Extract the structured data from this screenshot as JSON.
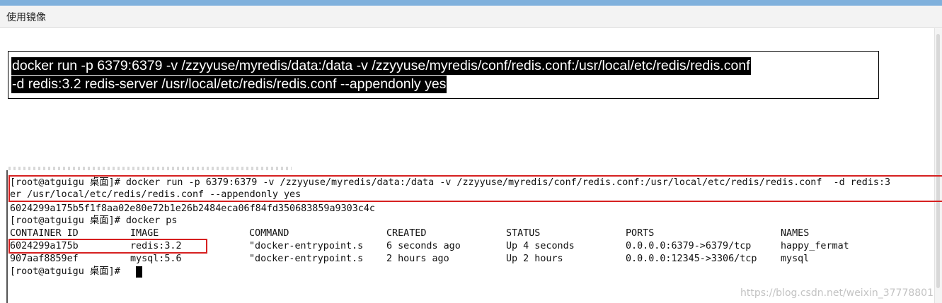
{
  "window": {
    "title": "使用镜像"
  },
  "command": {
    "line1": "docker run -p 6379:6379 -v /zzyyuse/myredis/data:/data -v /zzyyuse/myredis/conf/redis.conf:/usr/local/etc/redis/redis.conf",
    "line2": "-d redis:3.2 redis-server /usr/local/etc/redis/redis.conf --appendonly yes"
  },
  "terminal": {
    "lines": [
      "[root@atguigu 桌面]# docker run -p 6379:6379 -v /zzyyuse/myredis/data:/data -v /zzyyuse/myredis/conf/redis.conf:/usr/local/etc/redis/redis.conf  -d redis:3",
      "er /usr/local/etc/redis/redis.conf --appendonly yes",
      "6024299a175b5f1f8aa02e80e72b1e26b2484eca06f84fd350683859a9303c4c",
      "[root@atguigu 桌面]# docker ps"
    ],
    "table": {
      "headers": [
        "CONTAINER ID",
        "IMAGE",
        "COMMAND",
        "CREATED",
        "STATUS",
        "PORTS",
        "NAMES"
      ],
      "rows": [
        [
          "6024299a175b",
          "redis:3.2",
          "\"docker-entrypoint.s",
          "6 seconds ago",
          "Up 4 seconds",
          "0.0.0.0:6379->6379/tcp",
          "happy_fermat"
        ],
        [
          "907aaf8859ef",
          "mysql:5.6",
          "\"docker-entrypoint.s",
          "2 hours ago",
          "Up 2 hours",
          "0.0.0.0:12345->3306/tcp",
          "mysql"
        ]
      ]
    },
    "prompt": "[root@atguigu 桌面]# "
  },
  "watermark": "https://blog.csdn.net/weixin_37778801",
  "colors": {
    "highlight_red": "#d62020",
    "command_bg": "#000000",
    "command_fg": "#ffffff"
  }
}
